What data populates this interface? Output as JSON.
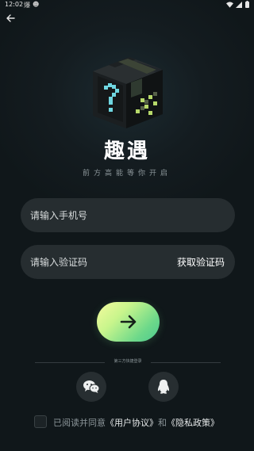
{
  "status_bar": {
    "time": "12:02",
    "extra1": "爆",
    "extra2": "☻"
  },
  "app": {
    "title": "趣遇",
    "slogan": "前方高能等你开启"
  },
  "form": {
    "phone_placeholder": "请输入手机号",
    "code_placeholder": "请输入验证码",
    "get_code_label": "获取验证码"
  },
  "divider_text": "第三方快捷登录",
  "agreement": {
    "prefix": "已阅读并同意",
    "user_agreement": "《用户协议》",
    "and": "和",
    "privacy_policy": "《隐私政策》"
  },
  "colors": {
    "background": "#141c20",
    "input_bg": "#262d30",
    "button_gradient_start": "#f4fb9e",
    "button_gradient_end": "#4cc98f",
    "muted_text": "#8b9599"
  },
  "icons": [
    "back-arrow-icon",
    "mystery-box-icon",
    "arrow-right-icon",
    "wechat-icon",
    "qq-icon",
    "wifi-icon",
    "signal-icon",
    "battery-icon"
  ]
}
